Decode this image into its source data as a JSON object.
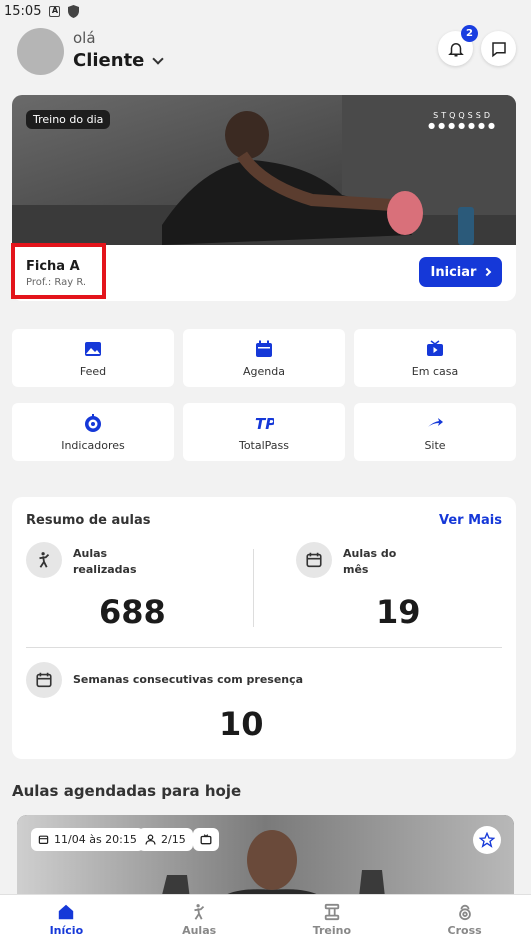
{
  "status_bar": {
    "time": "15:05",
    "icon_a": "A"
  },
  "header": {
    "greeting": "olá",
    "user_name": "Cliente",
    "notification_count": "2"
  },
  "hero": {
    "tag": "Treino do dia",
    "brand_line1": "STQQSSD",
    "brand_line2": "●●●●●●●",
    "ficha_title": "Ficha A",
    "ficha_sub": "Prof.: Ray R.",
    "start_label": "Iniciar"
  },
  "tiles": [
    {
      "label": "Feed",
      "icon": "image-icon"
    },
    {
      "label": "Agenda",
      "icon": "calendar-icon"
    },
    {
      "label": "Em casa",
      "icon": "tv-play-icon"
    },
    {
      "label": "Indicadores",
      "icon": "gauge-icon"
    },
    {
      "label": "TotalPass",
      "icon": "totalpass-icon"
    },
    {
      "label": "Site",
      "icon": "send-icon"
    }
  ],
  "summary": {
    "title": "Resumo de aulas",
    "ver_mais": "Ver Mais",
    "classes_done_label_1": "Aulas",
    "classes_done_label_2": "realizadas",
    "classes_done_value": "688",
    "classes_month_label_1": "Aulas do",
    "classes_month_label_2": "mês",
    "classes_month_value": "19",
    "weeks_label": "Semanas consecutivas com presença",
    "weeks_value": "10"
  },
  "today": {
    "section_title": "Aulas agendadas para hoje",
    "date_chip": "11/04 às 20:15",
    "people_chip": "2/15"
  },
  "bottom_nav": [
    {
      "label": "Início",
      "icon": "home-icon",
      "active": true
    },
    {
      "label": "Aulas",
      "icon": "gymnast-icon",
      "active": false
    },
    {
      "label": "Treino",
      "icon": "dumbbell-icon",
      "active": false
    },
    {
      "label": "Cross",
      "icon": "kettlebell-icon",
      "active": false
    }
  ],
  "colors": {
    "accent": "#1538d8",
    "highlight": "#e3141b",
    "background": "#f2f2f2"
  }
}
